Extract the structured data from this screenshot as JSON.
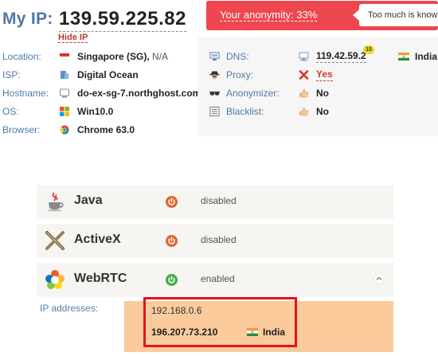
{
  "header": {
    "my_ip_label": "My IP:",
    "ip": "139.59.225.82",
    "hide_ip": "Hide IP"
  },
  "anonymity": {
    "text": "Your anonymity: 33%",
    "percent": 33,
    "tooltip": "Too much is known",
    "color": "#ee474f"
  },
  "info": [
    {
      "key": "Location:",
      "icon": "singapore-flag-icon",
      "value": "Singapore (SG),",
      "extra": "N/A"
    },
    {
      "key": "ISP:",
      "icon": "isp-icon",
      "value": "Digital Ocean",
      "extra": ""
    },
    {
      "key": "Hostname:",
      "icon": "monitor-icon",
      "value": "do-ex-sg-7.northghost.com",
      "extra": ""
    },
    {
      "key": "OS:",
      "icon": "windows-icon",
      "value": "Win10.0",
      "extra": ""
    },
    {
      "key": "Browser:",
      "icon": "chrome-icon",
      "value": "Chrome 63.0",
      "extra": ""
    }
  ],
  "details": {
    "dns": {
      "label": "DNS:",
      "value": "119.42.59.2",
      "badge": "15",
      "country": "India"
    },
    "proxy": {
      "label": "Proxy:",
      "value": "Yes"
    },
    "anonymizer": {
      "label": "Anonymizer:",
      "value": "No"
    },
    "blacklist": {
      "label": "Blacklist:",
      "value": "No"
    }
  },
  "plugins": [
    {
      "name": "Java",
      "status": "disabled",
      "icon": "java-icon",
      "power_color": "#e0662f"
    },
    {
      "name": "ActiveX",
      "status": "disabled",
      "icon": "activex-icon",
      "power_color": "#e0662f"
    },
    {
      "name": "WebRTC",
      "status": "enabled",
      "icon": "webrtc-icon",
      "power_color": "#3db04a"
    }
  ],
  "webrtc": {
    "ip_addresses_label": "IP addresses:",
    "local_ip": "192.168.0.6",
    "public_ip": "196.207.73.210",
    "public_country": "India"
  }
}
